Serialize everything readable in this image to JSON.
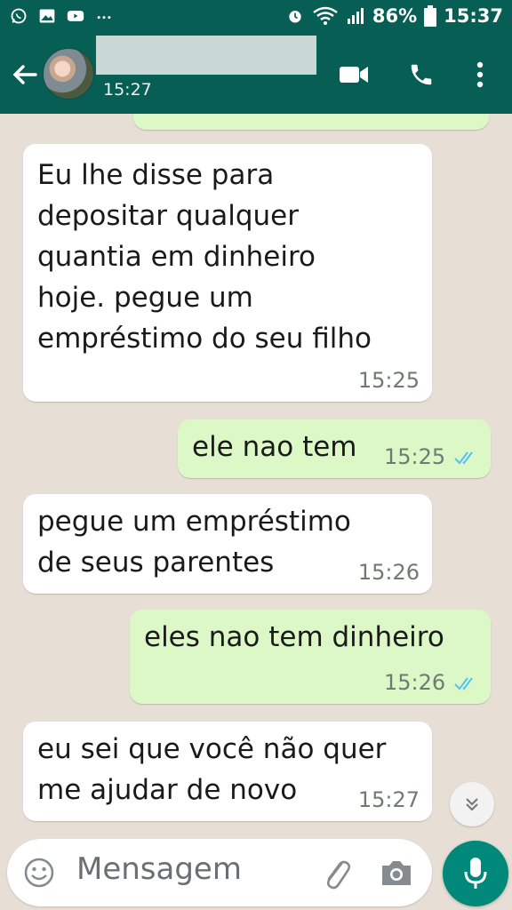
{
  "status_bar": {
    "battery": "86%",
    "time": "15:37",
    "left_icons": [
      "whatsapp-icon",
      "image-icon",
      "youtube-icon",
      "more-icon"
    ],
    "right_icons": [
      "alarm-icon",
      "wifi-icon",
      "signal-icon",
      "battery-icon"
    ]
  },
  "header": {
    "contact_name": "",
    "last_seen": "15:27",
    "icons": [
      "back-arrow-icon",
      "video-call-icon",
      "phone-call-icon",
      "overflow-menu-icon"
    ]
  },
  "messages": [
    {
      "direction": "in",
      "lines": [
        "Eu lhe disse para",
        "depositar qualquer",
        "quantia em dinheiro",
        "hoje.  pegue um",
        "empréstimo do seu filho"
      ],
      "time": "15:25"
    },
    {
      "direction": "out",
      "lines": [
        "ele nao tem"
      ],
      "time": "15:25",
      "read": true
    },
    {
      "direction": "in",
      "lines": [
        "pegue um empréstimo",
        "de seus parentes"
      ],
      "time": "15:26"
    },
    {
      "direction": "out",
      "lines": [
        "eles nao tem dinheiro"
      ],
      "time": "15:26",
      "read": true
    },
    {
      "direction": "in",
      "lines": [
        "eu sei que você não quer",
        "me ajudar de novo"
      ],
      "time": "15:27"
    }
  ],
  "input": {
    "placeholder": "Mensagem",
    "icons": [
      "emoji-icon",
      "attach-icon",
      "camera-icon",
      "mic-icon"
    ]
  },
  "colors": {
    "header": "#075e54",
    "chat_background": "#e7dfd5",
    "incoming_bubble": "#ffffff",
    "outgoing_bubble": "#dcf8c6",
    "read_ticks": "#4fc3f7",
    "mic_button": "#00897b"
  }
}
